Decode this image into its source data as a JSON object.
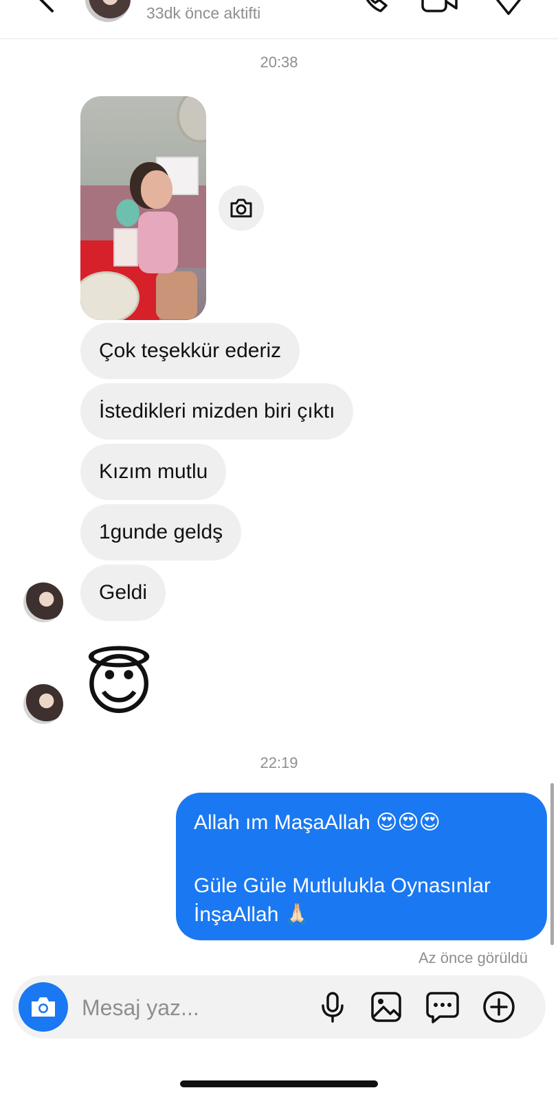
{
  "header": {
    "status": "33dk önce aktifti",
    "icons": [
      "back-icon",
      "phone-icon",
      "video-icon",
      "tag-icon"
    ]
  },
  "thread": {
    "time_1": "20:38",
    "incoming_messages": [
      "Çok teşekkür ederiz",
      "İstedikleri mizden biri çıktı",
      "Kızım mutlu",
      "1gunde geldş",
      "Geldi"
    ],
    "emoji_message": "😇",
    "time_2": "22:19",
    "outgoing": {
      "line1": "Allah ım MaşaAllah 😍😍😍",
      "line2": "Güle Güle Mutlulukla Oynasınlar",
      "line3": "İnşaAllah 🙏🏻"
    },
    "seen_status": "Az önce görüldü"
  },
  "composer": {
    "placeholder": "Mesaj yaz...",
    "icons": [
      "camera-icon",
      "microphone-icon",
      "gallery-icon",
      "sticker-icon",
      "plus-icon"
    ]
  },
  "colors": {
    "accent": "#1a78f2",
    "incoming_bubble": "#efefef",
    "muted_text": "#8e8e8e"
  }
}
